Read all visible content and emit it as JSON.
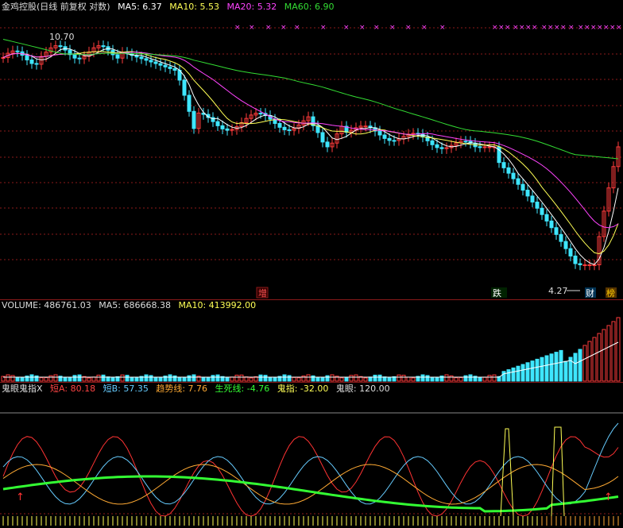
{
  "stock": {
    "title": "金鸡控股(日线 前复权 对数)",
    "ma5_label": "MA5: 6.37",
    "ma10_label": "MA10: 5.53",
    "ma20_label": "MA20: 5.32",
    "ma60_label": "MA60: 6.90"
  },
  "volume": {
    "title": "VOLUME: 486761.03",
    "ma5_label": "MA5: 686668.38",
    "ma10_label": "MA10: 413992.00"
  },
  "indicator": {
    "title": "鬼眼鬼指X",
    "shortA_label": "短A: 80.18",
    "shortB_label": "短B: 57.35",
    "trend_label": "趋势线: 7.76",
    "life_label": "生死线: -4.76",
    "ghost_finger_label": "鬼指: -32.00",
    "ghost_eye_label": "鬼眼: 120.00"
  },
  "annotations": {
    "high_label": "10.70",
    "low_label": "4.27",
    "tag_zeng": "增",
    "tag_die": "跌",
    "tag_cai": "财",
    "tag_bang": "榜"
  },
  "colors": {
    "up": "#ff3b3b",
    "down": "#3ee6ff",
    "ma5": "#ffffff",
    "ma10": "#ffff55",
    "ma20": "#ff44ff",
    "ma60": "#33dd33",
    "grid": "#8b1a1a"
  },
  "chart_data": {
    "type": "candlestick",
    "price_range": [
      4.27,
      10.7
    ],
    "volume_summary": {
      "volume": 486761.03,
      "ma5": 686668.38,
      "ma10": 413992.0
    },
    "indicator_summary": {
      "shortA": 80.18,
      "shortB": 57.35,
      "trend": 7.76,
      "life": -4.76,
      "ghost_finger": -32.0,
      "ghost_eye": 120.0
    }
  }
}
